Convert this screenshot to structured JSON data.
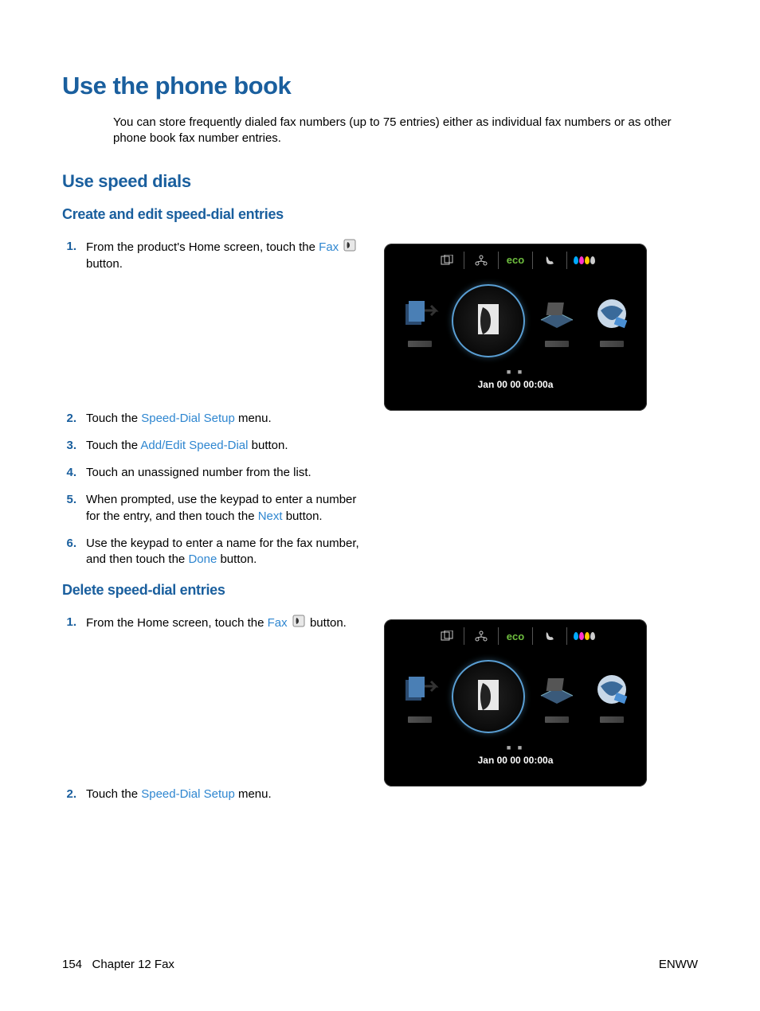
{
  "title": "Use the phone book",
  "intro": "You can store frequently dialed fax numbers (up to 75 entries) either as individual fax numbers or as other phone book fax number entries.",
  "section1": {
    "heading": "Use speed dials",
    "sub1": {
      "heading": "Create and edit speed-dial entries",
      "steps": {
        "s1a": "From the product's Home screen, touch the ",
        "s1b": "Fax",
        "s1c": " button.",
        "s2a": "Touch the ",
        "s2b": "Speed-Dial Setup",
        "s2c": " menu.",
        "s3a": "Touch the ",
        "s3b": "Add/Edit Speed-Dial",
        "s3c": " button.",
        "s4": "Touch an unassigned number from the list.",
        "s5a": "When prompted, use the keypad to enter a number for the entry, and then touch the ",
        "s5b": "Next",
        "s5c": " button.",
        "s6a": "Use the keypad to enter a name for the fax number, and then touch the ",
        "s6b": "Done",
        "s6c": " button."
      }
    },
    "sub2": {
      "heading": "Delete speed-dial entries",
      "steps": {
        "s1a": "From the Home screen, touch the ",
        "s1b": "Fax",
        "s1c": " button.",
        "s2a": "Touch the ",
        "s2b": "Speed-Dial Setup",
        "s2c": " menu."
      }
    }
  },
  "screen": {
    "eco": "eco",
    "datetime": "Jan 00 00 00:00a"
  },
  "footer": {
    "page": "154",
    "chapter": "Chapter 12   Fax",
    "right": "ENWW"
  }
}
